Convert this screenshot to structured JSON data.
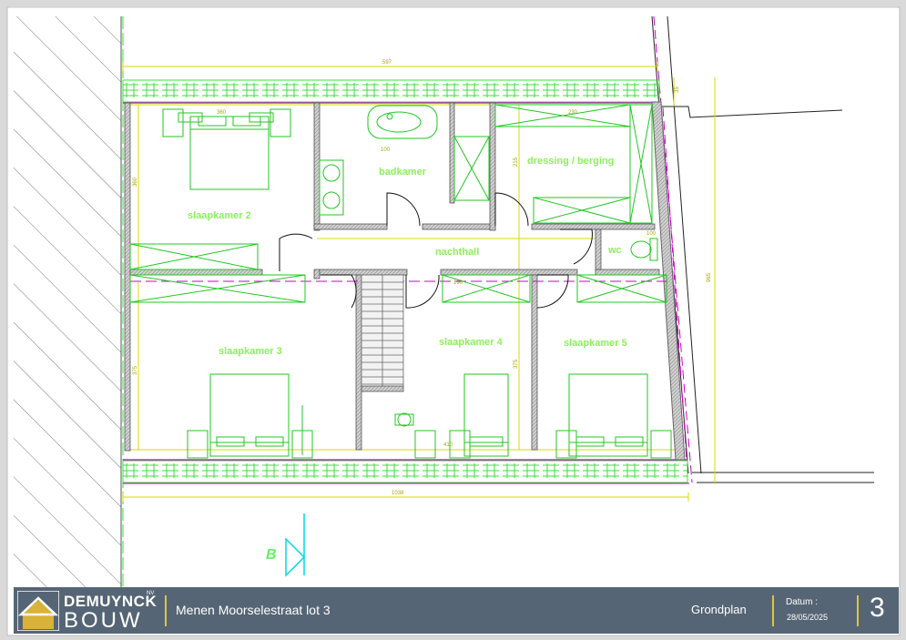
{
  "plan": {
    "rooms": {
      "slaapkamer2": "slaapkamer 2",
      "badkamer": "badkamer",
      "dressing": "dressing / berging",
      "nachthall": "nachthall",
      "wc": "wc",
      "slaapkamer3": "slaapkamer 3",
      "slaapkamer4": "slaapkamer 4",
      "slaapkamer5": "slaapkamer 5"
    },
    "section_marker": "B"
  },
  "titleblock": {
    "company_top": "DEMUYNCK",
    "company_suffix": "NV",
    "company_bottom": "BOUW",
    "project": "Menen Moorselestraat lot 3",
    "doc_type": "Grondplan",
    "date_label": "Datum :",
    "date_value": "28/05/2025",
    "page_number": "3"
  },
  "colors": {
    "wall_green": "#3ae03a",
    "furniture_green": "#22c722",
    "dim_yellow": "#d8d800",
    "magenta": "#d000d0",
    "cyan": "#00d8e8",
    "titlebar": "#566575",
    "logo_gold": "#d9b23a"
  }
}
